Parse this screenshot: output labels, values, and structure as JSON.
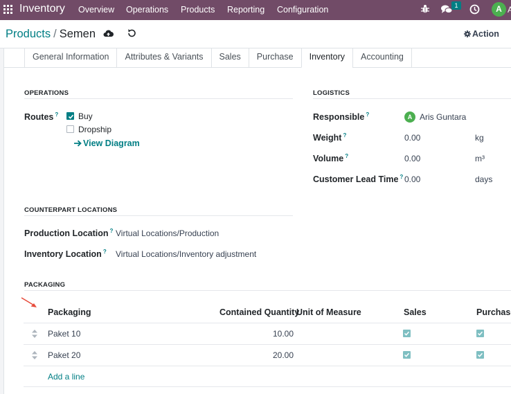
{
  "navbar": {
    "brand": "Inventory",
    "menu": [
      "Overview",
      "Operations",
      "Products",
      "Reporting",
      "Configuration"
    ],
    "chat_badge": "1",
    "user_initial": "A",
    "user_more": "A"
  },
  "breadcrumb": {
    "root": "Products",
    "separator": "/",
    "current": "Semen"
  },
  "control": {
    "action_label": "Action"
  },
  "tabs": [
    "General Information",
    "Attributes & Variants",
    "Sales",
    "Purchase",
    "Inventory",
    "Accounting"
  ],
  "operations": {
    "title": "OPERATIONS",
    "routes_label": "Routes",
    "routes": [
      {
        "label": "Buy",
        "checked": true
      },
      {
        "label": "Dropship",
        "checked": false
      }
    ],
    "view_diagram": "View Diagram"
  },
  "logistics": {
    "title": "LOGISTICS",
    "responsible_label": "Responsible",
    "responsible_initial": "A",
    "responsible_name": "Aris Guntara",
    "weight_label": "Weight",
    "weight_value": "0.00",
    "weight_unit": "kg",
    "volume_label": "Volume",
    "volume_value": "0.00",
    "volume_unit": "m³",
    "lead_label": "Customer Lead Time",
    "lead_value": "0.00",
    "lead_unit": "days"
  },
  "counterpart": {
    "title": "COUNTERPART LOCATIONS",
    "production_label": "Production Location",
    "production_value": "Virtual Locations/Production",
    "inventory_label": "Inventory Location",
    "inventory_value": "Virtual Locations/Inventory adjustment"
  },
  "packaging": {
    "title": "PACKAGING",
    "headers": [
      "Packaging",
      "Contained Quantity",
      "Unit of Measure",
      "Sales",
      "Purchase"
    ],
    "rows": [
      {
        "name": "Paket 10",
        "qty": "10.00",
        "uom": "",
        "sales": true,
        "purchase": true
      },
      {
        "name": "Paket 20",
        "qty": "20.00",
        "uom": "",
        "sales": true,
        "purchase": true
      }
    ],
    "add_line": "Add a line"
  },
  "help_mark": "?",
  "colors": {
    "navbar": "#714b67",
    "accent": "#017e84",
    "arrow": "#e74c3c"
  }
}
